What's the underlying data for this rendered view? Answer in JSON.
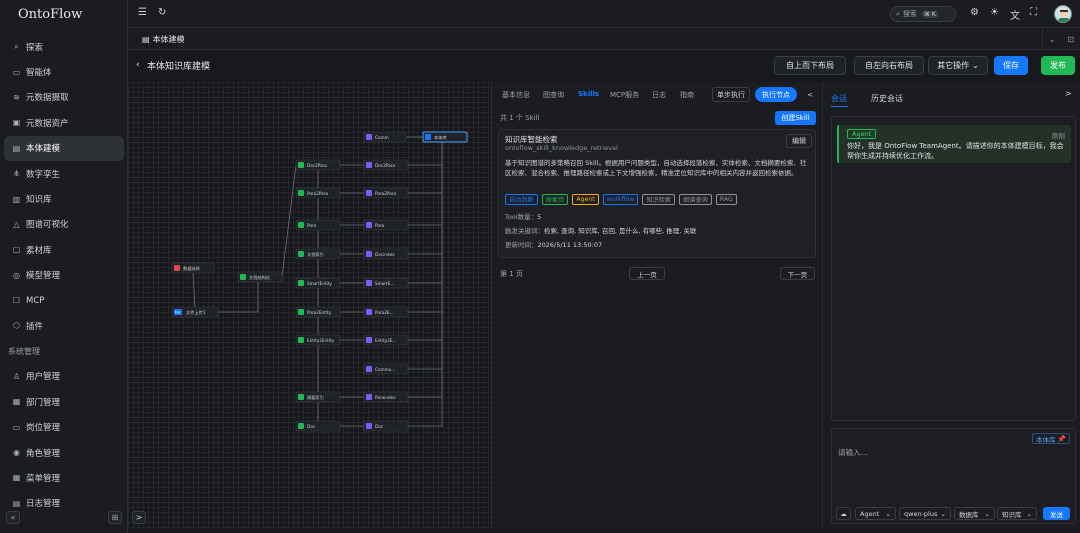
{
  "app": {
    "name": "OntoFlow"
  },
  "sidebar": {
    "items": [
      {
        "label": "探索",
        "icon": "search-icon",
        "glyph": "⌕"
      },
      {
        "label": "智能体",
        "icon": "agent-icon",
        "glyph": "▭"
      },
      {
        "label": "元数据摄取",
        "icon": "layers-icon",
        "glyph": "≋"
      },
      {
        "label": "元数据资产",
        "icon": "asset-icon",
        "glyph": "▣"
      },
      {
        "label": "本体建模",
        "icon": "model-icon",
        "glyph": "▤"
      },
      {
        "label": "数字孪生",
        "icon": "twin-icon",
        "glyph": "⋔"
      },
      {
        "label": "知识库",
        "icon": "book-icon",
        "glyph": "▥"
      },
      {
        "label": "图谱可视化",
        "icon": "graph-icon",
        "glyph": "△"
      },
      {
        "label": "素材库",
        "icon": "folder-icon",
        "glyph": "▢"
      },
      {
        "label": "模型管理",
        "icon": "model-manage-icon",
        "glyph": "◎"
      },
      {
        "label": "MCP",
        "icon": "mcp-icon",
        "glyph": "☐"
      },
      {
        "label": "插件",
        "icon": "plugin-icon",
        "glyph": "⬡"
      }
    ],
    "section": "系统管理",
    "system_items": [
      {
        "label": "用户管理",
        "icon": "user-icon",
        "glyph": "♙"
      },
      {
        "label": "部门管理",
        "icon": "department-icon",
        "glyph": "▦"
      },
      {
        "label": "岗位管理",
        "icon": "post-icon",
        "glyph": "▭"
      },
      {
        "label": "角色管理",
        "icon": "role-icon",
        "glyph": "◉"
      },
      {
        "label": "菜单管理",
        "icon": "menu-icon",
        "glyph": "▦"
      },
      {
        "label": "日志管理",
        "icon": "log-icon",
        "glyph": "▤"
      }
    ]
  },
  "topbar": {
    "search_placeholder": "搜索",
    "shortcut": "⌘ K"
  },
  "tabs": {
    "active": "本体建模"
  },
  "header": {
    "title": "本体知识库建模",
    "btn_top_down": "自上而下布局",
    "btn_left_right": "自左向右布局",
    "btn_other": "其它操作",
    "btn_save": "保存",
    "btn_publish": "发布"
  },
  "canvas": {
    "nodes": [
      {
        "label": "数据选择",
        "color": "#e0474c"
      },
      {
        "label": "文件上传1",
        "color": "#1677ff",
        "badge": "File"
      },
      {
        "label": "文档结构化",
        "color": "#21b856"
      },
      {
        "label": "Doc2Para",
        "color": "#21b856"
      },
      {
        "label": "Para2Para",
        "color": "#21b856"
      },
      {
        "label": "Para",
        "color": "#21b856"
      },
      {
        "label": "文档索引",
        "color": "#21b856"
      },
      {
        "label": "SmartEntity",
        "color": "#21b856"
      },
      {
        "label": "Para2Entity",
        "color": "#21b856"
      },
      {
        "label": "Entity2Entity",
        "color": "#21b856"
      },
      {
        "label": "摘要索引",
        "color": "#21b856"
      },
      {
        "label": "Doc",
        "color": "#21b856"
      },
      {
        "label": "Comm",
        "color": "#7c5cff"
      },
      {
        "label": "Doc2Para",
        "color": "#7c5cff"
      },
      {
        "label": "Para2Para",
        "color": "#7c5cff"
      },
      {
        "label": "Para",
        "color": "#7c5cff"
      },
      {
        "label": "Docindex",
        "color": "#7c5cff"
      },
      {
        "label": "SmartE...",
        "color": "#7c5cff"
      },
      {
        "label": "Para2E...",
        "color": "#7c5cff"
      },
      {
        "label": "Entity2E...",
        "color": "#7c5cff"
      },
      {
        "label": "Commu...",
        "color": "#7c5cff"
      },
      {
        "label": "Paraindex",
        "color": "#7c5cff"
      },
      {
        "label": "Doc",
        "color": "#7c5cff"
      },
      {
        "label": "本体库",
        "color": "#1677ff"
      }
    ]
  },
  "detail": {
    "tabs": [
      "基本信息",
      "图查询",
      "Skills",
      "MCP服务",
      "日志",
      "指南"
    ],
    "active_tab": "Skills",
    "btn_step": "单步执行",
    "btn_run": "执行节点",
    "collapse": "<",
    "count": "共 1 个 Skill",
    "create_btn": "创建Skill",
    "card": {
      "title": "知识库智能检索",
      "id": "ontoflow_skill_knowledge_retrieval",
      "edit": "编辑",
      "desc": "基于知识图谱的多策略召回 Skill。根据用户问题类型，自动选择段落检索、实体检索、文档摘要检索、社区检索、混合检索、推理路径检索或上下文增强检索，精准定位知识库中的相关内容并返回检索依据。",
      "tags": [
        {
          "label": "自动判断",
          "color": "#1677ff"
        },
        {
          "label": "探索页",
          "color": "#21b856"
        },
        {
          "label": "Agent",
          "color": "#faad14"
        },
        {
          "label": "workflow",
          "color": "#1677ff"
        },
        {
          "label": "知识检索",
          "color": "#8e9298"
        },
        {
          "label": "图谱查询",
          "color": "#8e9298"
        },
        {
          "label": "RAG",
          "color": "#8e9298"
        }
      ],
      "tool_label": "Tool数量：",
      "tool_count": "5",
      "kw_label": "触发关键词：",
      "keywords": "检索, 查询, 知识库, 召回, 是什么, 有哪些, 推理, 关联",
      "updated_label": "更新时间：",
      "updated": "2026/5/11 13:50:07"
    },
    "page": "第 1 页",
    "prev": "上一页",
    "next": "下一页"
  },
  "chat": {
    "tab_active": "会话",
    "tab_history": "历史会话",
    "expand": ">",
    "msg_badge": "Agent",
    "msg_time": "刚刚",
    "msg_text": "你好，我是 OntoFlow TeamAgent。请描述你的本体建模目标，我会帮你生成并持续优化工作流。",
    "input_placeholder": "请输入...",
    "kb_badge": "本体库",
    "agent_sel": "Agent",
    "model_sel": "qwen-plus",
    "db_sel": "数据库",
    "kb_sel": "知识库",
    "send": "发送"
  }
}
